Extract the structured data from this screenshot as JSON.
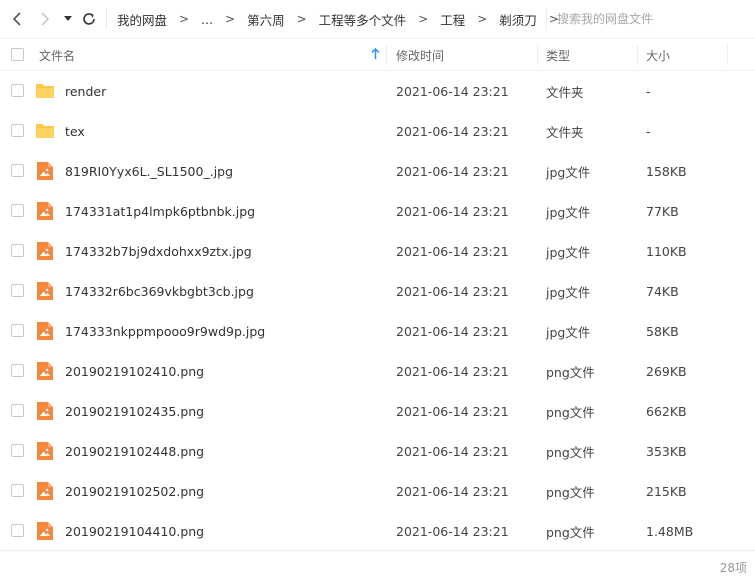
{
  "toolbar": {
    "breadcrumb": [
      "我的网盘",
      "...",
      "第六周",
      "工程等多个文件",
      "工程",
      "剃须刀"
    ],
    "separator": ">",
    "search_placeholder": "搜索我的网盘文件"
  },
  "header": {
    "name": "文件名",
    "mtime": "修改时间",
    "type": "类型",
    "size": "大小"
  },
  "icons": {
    "back": "chevron-left-icon",
    "forward": "chevron-right-icon",
    "dropdown": "caret-down-icon",
    "refresh": "refresh-icon",
    "sort": "arrow-up-icon",
    "folder": "folder-icon",
    "image": "image-file-icon"
  },
  "colors": {
    "folder": "#f9c74a",
    "image_file": "#f5863b",
    "accent": "#2f8fe6"
  },
  "files": [
    {
      "name": "render",
      "mtime": "2021-06-14 23:21",
      "type": "文件夹",
      "size": "-",
      "kind": "folder"
    },
    {
      "name": "tex",
      "mtime": "2021-06-14 23:21",
      "type": "文件夹",
      "size": "-",
      "kind": "folder"
    },
    {
      "name": "819RI0Yyx6L._SL1500_.jpg",
      "mtime": "2021-06-14 23:21",
      "type": "jpg文件",
      "size": "158KB",
      "kind": "image"
    },
    {
      "name": "174331at1p4lmpk6ptbnbk.jpg",
      "mtime": "2021-06-14 23:21",
      "type": "jpg文件",
      "size": "77KB",
      "kind": "image"
    },
    {
      "name": "174332b7bj9dxdohxx9ztx.jpg",
      "mtime": "2021-06-14 23:21",
      "type": "jpg文件",
      "size": "110KB",
      "kind": "image"
    },
    {
      "name": "174332r6bc369vkbgbt3cb.jpg",
      "mtime": "2021-06-14 23:21",
      "type": "jpg文件",
      "size": "74KB",
      "kind": "image"
    },
    {
      "name": "174333nkppmpooo9r9wd9p.jpg",
      "mtime": "2021-06-14 23:21",
      "type": "jpg文件",
      "size": "58KB",
      "kind": "image"
    },
    {
      "name": "20190219102410.png",
      "mtime": "2021-06-14 23:21",
      "type": "png文件",
      "size": "269KB",
      "kind": "image"
    },
    {
      "name": "20190219102435.png",
      "mtime": "2021-06-14 23:21",
      "type": "png文件",
      "size": "662KB",
      "kind": "image"
    },
    {
      "name": "20190219102448.png",
      "mtime": "2021-06-14 23:21",
      "type": "png文件",
      "size": "353KB",
      "kind": "image"
    },
    {
      "name": "20190219102502.png",
      "mtime": "2021-06-14 23:21",
      "type": "png文件",
      "size": "215KB",
      "kind": "image"
    },
    {
      "name": "20190219104410.png",
      "mtime": "2021-06-14 23:21",
      "type": "png文件",
      "size": "1.48MB",
      "kind": "image"
    }
  ],
  "footer": {
    "count": "28项"
  }
}
